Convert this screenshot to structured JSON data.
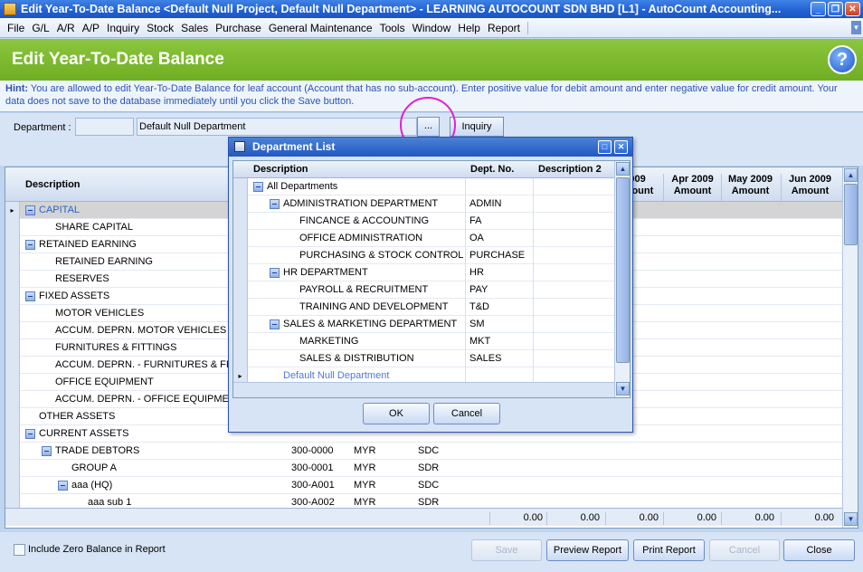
{
  "window": {
    "title": "Edit Year-To-Date Balance <Default Null Project, Default Null Department> - LEARNING AUTOCOUNT SDN BHD [L1] - AutoCount Accounting..."
  },
  "menu": [
    "File",
    "G/L",
    "A/R",
    "A/P",
    "Inquiry",
    "Stock",
    "Sales",
    "Purchase",
    "General Maintenance",
    "Tools",
    "Window",
    "Help",
    "Report"
  ],
  "header": {
    "title": "Edit Year-To-Date Balance"
  },
  "hint": {
    "label": "Hint:",
    "text": "You are allowed to edit Year-To-Date Balance for leaf account (Account that has no sub-account). Enter positive value for debit amount and enter negative value for credit amount. Your data does not save to the database immediately until you click the Save button."
  },
  "department": {
    "label": "Department :",
    "code": "",
    "name": "Default Null Department",
    "lookup_button": "...",
    "inquiry_button": "Inquiry"
  },
  "grid": {
    "col_description": "Description",
    "month_columns": [
      "2009 Amount",
      "Apr 2009 Amount",
      "May 2009 Amount",
      "Jun 2009 Amount"
    ],
    "rows": [
      {
        "desc": "CAPITAL",
        "level": 0,
        "expand": true,
        "link": true,
        "acc": "",
        "cur": "",
        "type": ""
      },
      {
        "desc": "SHARE CAPITAL",
        "level": 1,
        "expand": false,
        "acc": "",
        "cur": "",
        "type": ""
      },
      {
        "desc": "RETAINED EARNING",
        "level": 0,
        "expand": true,
        "acc": "",
        "cur": "",
        "type": ""
      },
      {
        "desc": "RETAINED EARNING",
        "level": 1,
        "expand": false,
        "acc": "",
        "cur": "",
        "type": ""
      },
      {
        "desc": "RESERVES",
        "level": 1,
        "expand": false,
        "acc": "",
        "cur": "",
        "type": ""
      },
      {
        "desc": "FIXED ASSETS",
        "level": 0,
        "expand": true,
        "acc": "",
        "cur": "",
        "type": ""
      },
      {
        "desc": "MOTOR VEHICLES",
        "level": 1,
        "expand": false,
        "acc": "",
        "cur": "",
        "type": ""
      },
      {
        "desc": "ACCUM. DEPRN. MOTOR VEHICLES",
        "level": 1,
        "expand": false,
        "acc": "",
        "cur": "",
        "type": ""
      },
      {
        "desc": "FURNITURES & FITTINGS",
        "level": 1,
        "expand": false,
        "acc": "",
        "cur": "",
        "type": ""
      },
      {
        "desc": "ACCUM. DEPRN. - FURNITURES & FITTI",
        "level": 1,
        "expand": false,
        "acc": "",
        "cur": "",
        "type": ""
      },
      {
        "desc": "OFFICE EQUIPMENT",
        "level": 1,
        "expand": false,
        "acc": "",
        "cur": "",
        "type": ""
      },
      {
        "desc": "ACCUM. DEPRN. - OFFICE EQUIPMENT",
        "level": 1,
        "expand": false,
        "acc": "",
        "cur": "",
        "type": ""
      },
      {
        "desc": "OTHER ASSETS",
        "level": 0,
        "expand": false,
        "acc": "",
        "cur": "",
        "type": ""
      },
      {
        "desc": "CURRENT ASSETS",
        "level": 0,
        "expand": true,
        "acc": "",
        "cur": "",
        "type": ""
      },
      {
        "desc": "TRADE DEBTORS",
        "level": 1,
        "expand": true,
        "acc": "300-0000",
        "cur": "MYR",
        "type": "SDC"
      },
      {
        "desc": "GROUP A",
        "level": 2,
        "expand": false,
        "acc": "300-0001",
        "cur": "MYR",
        "type": "SDR"
      },
      {
        "desc": "aaa (HQ)",
        "level": 2,
        "expand": true,
        "acc": "300-A001",
        "cur": "MYR",
        "type": "SDC"
      },
      {
        "desc": "aaa sub 1",
        "level": 3,
        "expand": false,
        "acc": "300-A002",
        "cur": "MYR",
        "type": "SDR"
      }
    ],
    "totals": [
      "0.00",
      "0.00",
      "0.00",
      "0.00",
      "0.00",
      "0.00"
    ]
  },
  "bottom": {
    "include_zero_label": "Include Zero Balance in Report",
    "save": "Save",
    "preview": "Preview Report",
    "print": "Print Report",
    "cancel": "Cancel",
    "close": "Close"
  },
  "dialog": {
    "title": "Department List",
    "col_description": "Description",
    "col_dept_no": "Dept. No.",
    "col_description2": "Description 2",
    "rows": [
      {
        "desc": "All Departments",
        "level": 0,
        "expand": true,
        "no": ""
      },
      {
        "desc": "ADMINISTRATION DEPARTMENT",
        "level": 1,
        "expand": true,
        "no": "ADMIN"
      },
      {
        "desc": "FINCANCE & ACCOUNTING",
        "level": 2,
        "expand": false,
        "no": "FA"
      },
      {
        "desc": "OFFICE ADMINISTRATION",
        "level": 2,
        "expand": false,
        "no": "OA"
      },
      {
        "desc": "PURCHASING & STOCK CONTROL",
        "level": 2,
        "expand": false,
        "no": "PURCHASE"
      },
      {
        "desc": "HR DEPARTMENT",
        "level": 1,
        "expand": true,
        "no": "HR"
      },
      {
        "desc": "PAYROLL & RECRUITMENT",
        "level": 2,
        "expand": false,
        "no": "PAY"
      },
      {
        "desc": "TRAINING AND DEVELOPMENT",
        "level": 2,
        "expand": false,
        "no": "T&D"
      },
      {
        "desc": "SALES & MARKETING DEPARTMENT",
        "level": 1,
        "expand": true,
        "no": "SM"
      },
      {
        "desc": "MARKETING",
        "level": 2,
        "expand": false,
        "no": "MKT"
      },
      {
        "desc": "SALES & DISTRIBUTION",
        "level": 2,
        "expand": false,
        "no": "SALES"
      },
      {
        "desc": "Default Null Department",
        "level": 1,
        "expand": false,
        "no": "",
        "current": true
      }
    ],
    "ok": "OK",
    "cancel": "Cancel"
  }
}
